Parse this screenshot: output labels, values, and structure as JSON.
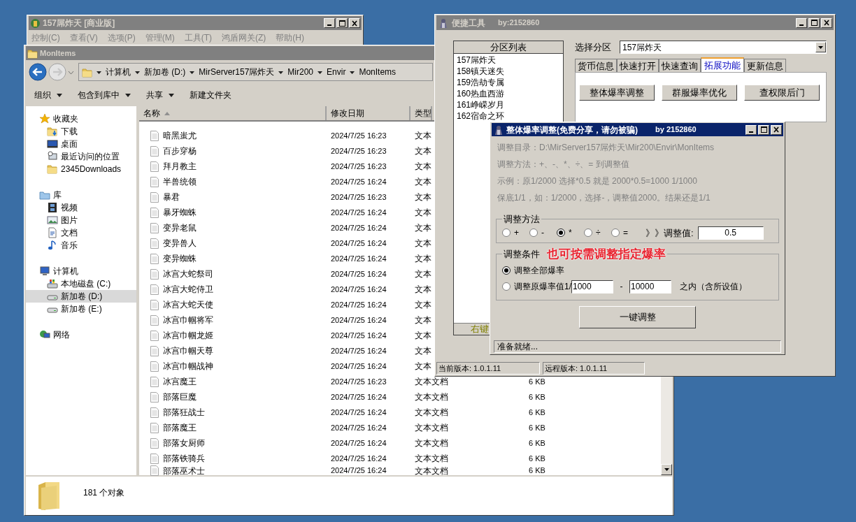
{
  "back_window": {
    "title": "157屌炸天 [商业版]",
    "menu": [
      "控制(C)",
      "查看(V)",
      "选项(P)",
      "管理(M)",
      "工具(T)",
      "鸿盾网关(Z)",
      "帮助(H)"
    ]
  },
  "explorer": {
    "title": "MonItems",
    "breadcrumb": [
      "计算机",
      "新加卷 (D:)",
      "MirServer157屌炸天",
      "Mir200",
      "Envir",
      "MonItems"
    ],
    "toolbar": [
      {
        "label": "组织",
        "dropdown": true
      },
      {
        "label": "包含到库中",
        "dropdown": true
      },
      {
        "label": "共享",
        "dropdown": true
      },
      {
        "label": "新建文件夹",
        "dropdown": false
      }
    ],
    "nav": [
      {
        "label": "收藏夹",
        "selected": false,
        "children": [
          {
            "label": "下载",
            "selected": false
          },
          {
            "label": "桌面",
            "selected": false
          },
          {
            "label": "最近访问的位置",
            "selected": false
          },
          {
            "label": "2345Downloads",
            "selected": false
          }
        ]
      },
      {
        "label": "库",
        "selected": false,
        "children": [
          {
            "label": "视频",
            "selected": false
          },
          {
            "label": "图片",
            "selected": false
          },
          {
            "label": "文档",
            "selected": false
          },
          {
            "label": "音乐",
            "selected": false
          }
        ]
      },
      {
        "label": "计算机",
        "selected": false,
        "children": [
          {
            "label": "本地磁盘 (C:)",
            "selected": false
          },
          {
            "label": "新加卷 (D:)",
            "selected": true
          },
          {
            "label": "新加卷 (E:)",
            "selected": false
          }
        ]
      },
      {
        "label": "网络",
        "selected": false
      }
    ],
    "columns": [
      "名称",
      "修改日期",
      "类型"
    ],
    "files": [
      {
        "name": "暗黑蚩尤",
        "modified": "2024/7/25 16:23",
        "type": "文本"
      },
      {
        "name": "百步穿杨",
        "modified": "2024/7/25 16:23",
        "type": "文本"
      },
      {
        "name": "拜月教主",
        "modified": "2024/7/25 16:23",
        "type": "文本"
      },
      {
        "name": "半兽统领",
        "modified": "2024/7/25 16:24",
        "type": "文本"
      },
      {
        "name": "暴君",
        "modified": "2024/7/25 16:23",
        "type": "文本"
      },
      {
        "name": "暴牙蜘蛛",
        "modified": "2024/7/25 16:24",
        "type": "文本"
      },
      {
        "name": "变异老鼠",
        "modified": "2024/7/25 16:24",
        "type": "文本"
      },
      {
        "name": "变异兽人",
        "modified": "2024/7/25 16:24",
        "type": "文本"
      },
      {
        "name": "变异蜘蛛",
        "modified": "2024/7/25 16:24",
        "type": "文本"
      },
      {
        "name": "冰宫大蛇祭司",
        "modified": "2024/7/25 16:24",
        "type": "文本"
      },
      {
        "name": "冰宫大蛇侍卫",
        "modified": "2024/7/25 16:24",
        "type": "文本"
      },
      {
        "name": "冰宫大蛇天使",
        "modified": "2024/7/25 16:24",
        "type": "文本"
      },
      {
        "name": "冰宫巾帼将军",
        "modified": "2024/7/25 16:24",
        "type": "文本"
      },
      {
        "name": "冰宫巾帼龙姬",
        "modified": "2024/7/25 16:24",
        "type": "文本"
      },
      {
        "name": "冰宫巾帼天尊",
        "modified": "2024/7/25 16:24",
        "type": "文本"
      },
      {
        "name": "冰宫巾帼战神",
        "modified": "2024/7/25 16:24",
        "type": "文本"
      },
      {
        "name": "冰宫魔王",
        "modified": "2024/7/25 16:23",
        "type": "文本文档",
        "size": "6 KB"
      },
      {
        "name": "部落巨魔",
        "modified": "2024/7/25 16:24",
        "type": "文本文档",
        "size": "6 KB"
      },
      {
        "name": "部落狂战士",
        "modified": "2024/7/25 16:24",
        "type": "文本文档",
        "size": "6 KB"
      },
      {
        "name": "部落魔王",
        "modified": "2024/7/25 16:24",
        "type": "文本文档",
        "size": "6 KB"
      },
      {
        "name": "部落女厨师",
        "modified": "2024/7/25 16:24",
        "type": "文本文档",
        "size": "6 KB"
      },
      {
        "name": "部落铁骑兵",
        "modified": "2024/7/25 16:24",
        "type": "文本文档",
        "size": "6 KB"
      },
      {
        "name": "部落巫术士",
        "modified": "2024/7/25 16:24",
        "type": "文本文档",
        "size": "6 KB"
      }
    ],
    "status": "181 个对象"
  },
  "tool_window": {
    "title": "便捷工具",
    "byline": "by:2152860",
    "partition_list": {
      "header": "分区列表",
      "items": [
        {
          "label": "157屌炸天",
          "selected": false
        },
        {
          "label": "158镇天迷失",
          "selected": false
        },
        {
          "label": "159浩劫专属",
          "selected": false
        },
        {
          "label": "160热血西游",
          "selected": false
        },
        {
          "label": "161峥嵘岁月",
          "selected": false
        },
        {
          "label": "162宿命之环",
          "selected": false
        }
      ],
      "footer": "右键"
    },
    "select_label": "选择分区",
    "select_value": "157屌炸天",
    "tabs": [
      {
        "label": "货币信息",
        "selected": false
      },
      {
        "label": "快速打开",
        "selected": false
      },
      {
        "label": "快速查询",
        "selected": false
      },
      {
        "label": "拓展功能",
        "selected": true
      },
      {
        "label": "更新信息",
        "selected": false
      }
    ],
    "buttons": [
      "整体爆率调整",
      "群服爆率优化",
      "查权限后门"
    ],
    "status": [
      "当前版本: 1.0.1.11",
      "远程版本: 1.0.1.11"
    ]
  },
  "dialog": {
    "title": "整体爆率调整(免费分享，请勿被骗)",
    "byline": "by 2152860",
    "info_lines": [
      "调整目录：D:\\MirServer157屌炸天\\Mir200\\Envir\\MonItems",
      "调整方法：+、-、*、÷、=   到调整值",
      "示例：原1/2000 选择*0.5 就是 2000*0.5=1000  1/1000",
      "保底1/1，如：1/2000，选择-，调整值2000。结果还是1/1"
    ],
    "method_group": {
      "title": "调整方法",
      "options": [
        {
          "label": "+",
          "selected": false
        },
        {
          "label": "-",
          "selected": false
        },
        {
          "label": "*",
          "selected": true
        },
        {
          "label": "÷",
          "selected": false
        },
        {
          "label": "=",
          "selected": false
        }
      ],
      "value_label": "》》调整值:",
      "value": "0.5"
    },
    "condition_group": {
      "title": "调整条件",
      "annotation": "也可按需调整指定爆率",
      "options": [
        {
          "label": "调整全部爆率",
          "selected": true
        },
        {
          "label": "调整原爆率值1/",
          "selected": false
        }
      ],
      "from": "1000",
      "separator": "-",
      "to": "10000",
      "suffix": "之内（含所设值）"
    },
    "run_button": "一键调整",
    "status": "准备就绪..."
  }
}
